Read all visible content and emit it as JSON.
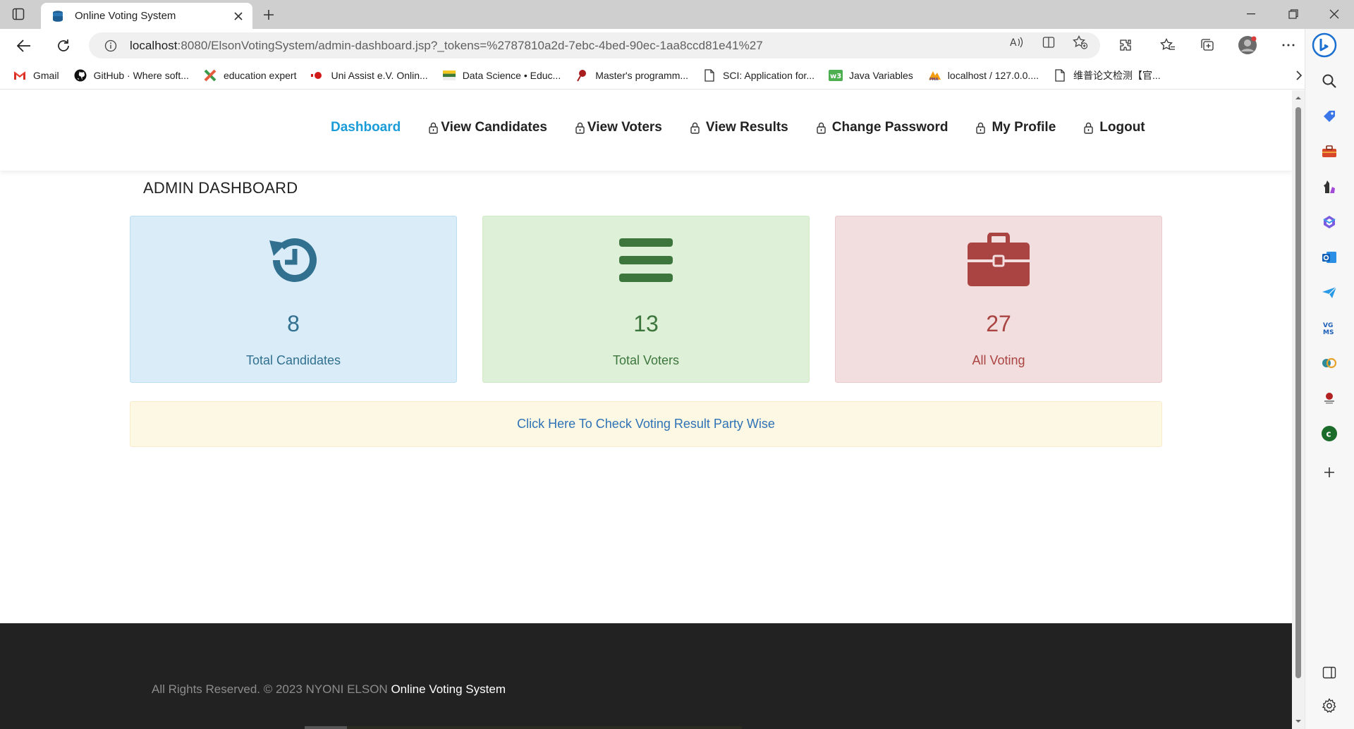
{
  "browser": {
    "tab": {
      "title": "Online Voting System"
    },
    "url": {
      "host": "localhost",
      "rest": ":8080/ElsonVotingSystem/admin-dashboard.jsp?_tokens=%2787810a2d-7ebc-4bed-90ec-1aa8ccd81e41%27"
    },
    "bookmarks": [
      {
        "label": "Gmail",
        "icon": "gmail-icon"
      },
      {
        "label": "GitHub · Where soft...",
        "icon": "github-icon"
      },
      {
        "label": "education expert",
        "icon": "x-logo-icon"
      },
      {
        "label": "Uni Assist e.V. Onlin...",
        "icon": "uni-assist-icon"
      },
      {
        "label": "Data Science • Educ...",
        "icon": "flag-icon"
      },
      {
        "label": "Master's programm...",
        "icon": "pin-icon"
      },
      {
        "label": "SCI: Application for...",
        "icon": "document-icon"
      },
      {
        "label": "Java Variables",
        "icon": "w3-icon"
      },
      {
        "label": "localhost / 127.0.0....",
        "icon": "phpmyadmin-icon"
      },
      {
        "label": "维普论文检测【官...",
        "icon": "document-icon"
      }
    ]
  },
  "nav": {
    "items": [
      {
        "label": "Dashboard"
      },
      {
        "label": "View Candidates"
      },
      {
        "label": "View Voters"
      },
      {
        "label": "View Results"
      },
      {
        "label": "Change Password"
      },
      {
        "label": "My Profile"
      },
      {
        "label": "Logout"
      }
    ]
  },
  "dashboard": {
    "title": "ADMIN DASHBOARD",
    "cards": [
      {
        "value": "8",
        "label": "Total Candidates",
        "icon": "history-icon"
      },
      {
        "value": "13",
        "label": "Total Voters",
        "icon": "bars-icon"
      },
      {
        "value": "27",
        "label": "All Voting",
        "icon": "briefcase-icon"
      }
    ],
    "result_link": "Click Here To Check Voting Result Party Wise"
  },
  "footer": {
    "text": "All Rights Reserved. © 2023 NYONI ELSON",
    "brand": "Online Voting System"
  },
  "colors": {
    "nav_active": "#1a9cd8",
    "card_blue": "#d9ecf7",
    "card_green": "#dff0d8",
    "card_red": "#f2dede",
    "result_bar": "#fcf8e3",
    "footer": "#222222"
  }
}
